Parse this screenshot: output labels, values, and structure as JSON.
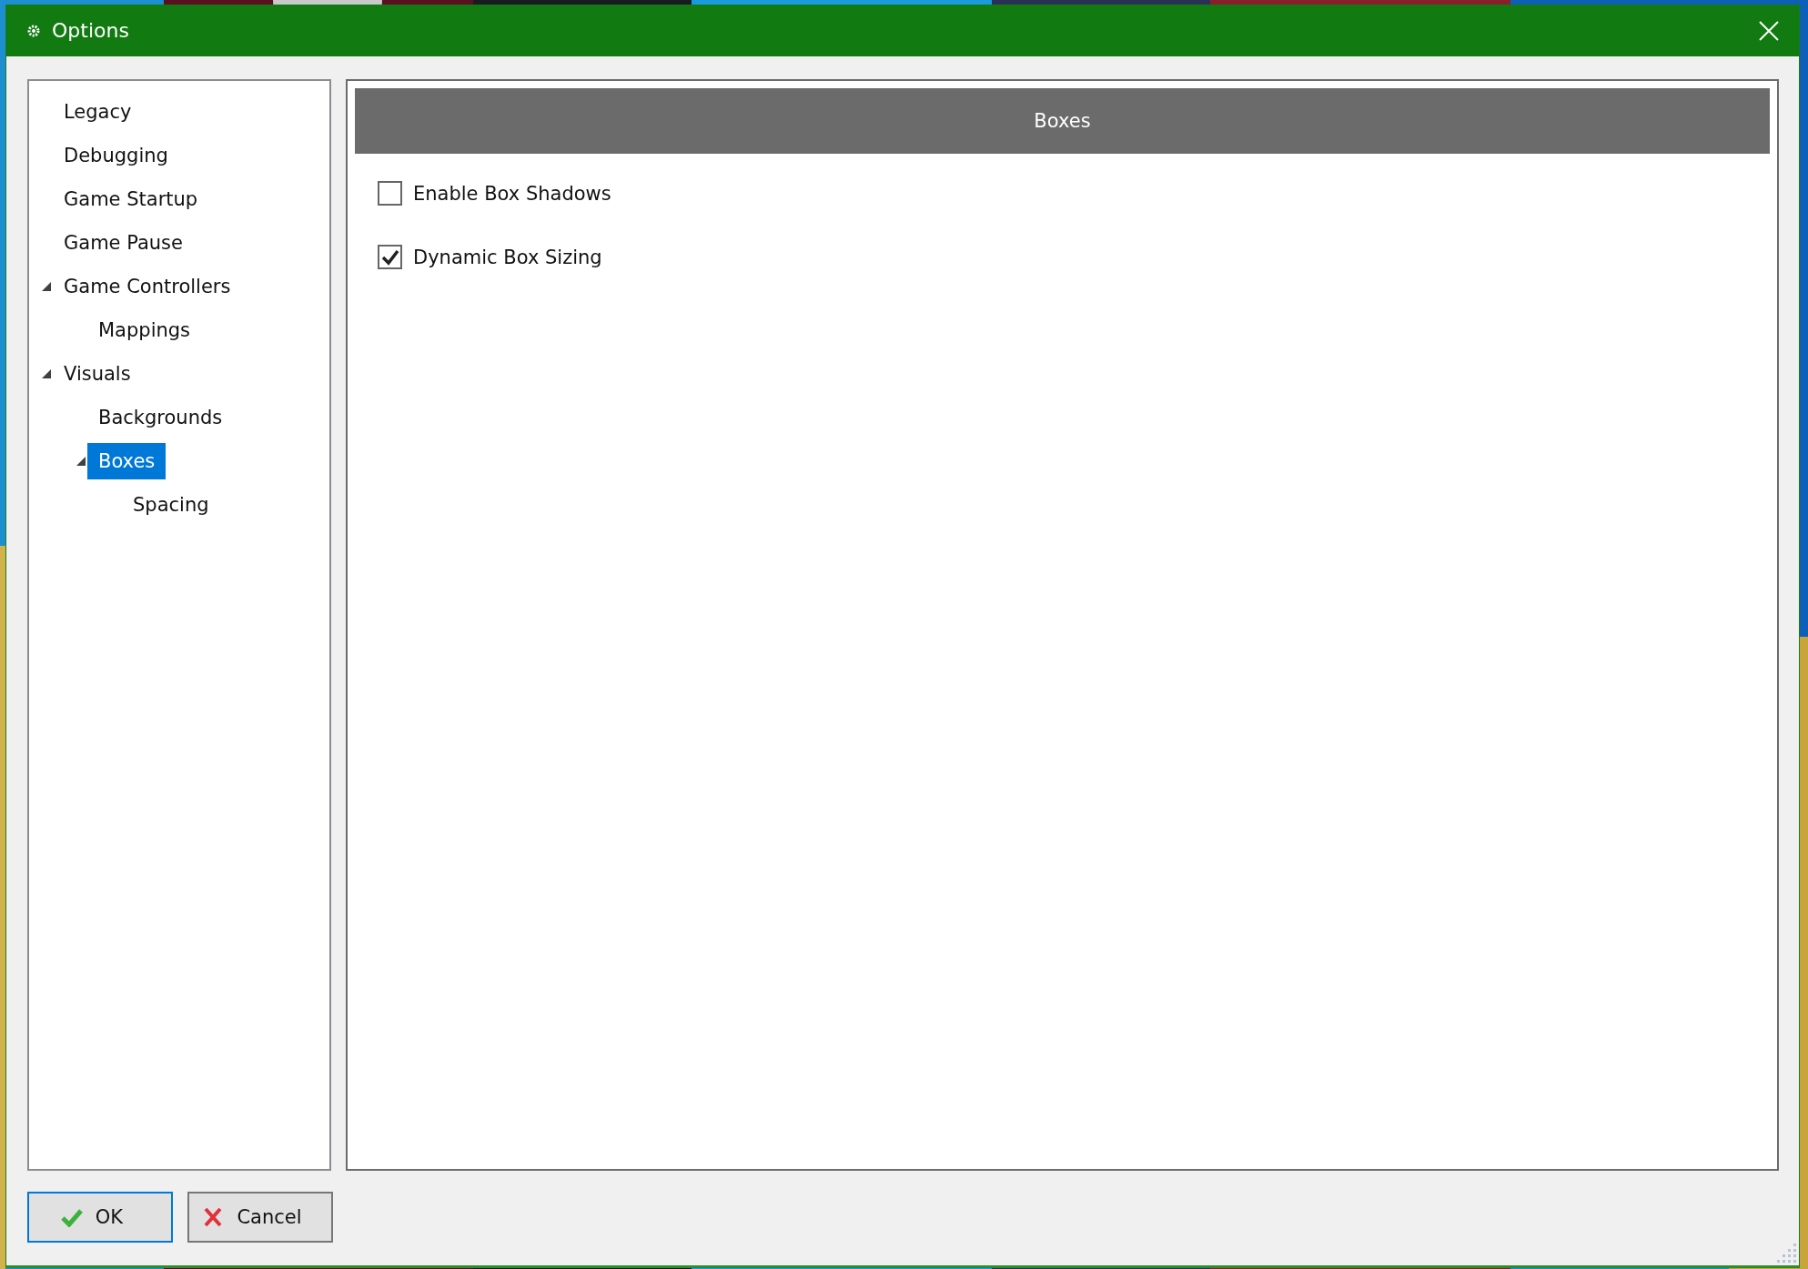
{
  "window": {
    "title": "Options"
  },
  "tree": [
    {
      "label": "Legacy",
      "selected": false
    },
    {
      "label": "Debugging",
      "selected": false
    },
    {
      "label": "Game Startup",
      "selected": false
    },
    {
      "label": "Game Pause",
      "selected": false
    },
    {
      "label": "Game Controllers",
      "selected": false,
      "expanded": true,
      "children": [
        {
          "label": "Mappings",
          "selected": false
        }
      ]
    },
    {
      "label": "Visuals",
      "selected": false,
      "expanded": true,
      "children": [
        {
          "label": "Backgrounds",
          "selected": false
        },
        {
          "label": "Boxes",
          "selected": true,
          "expanded": true,
          "children": [
            {
              "label": "Spacing",
              "selected": false
            }
          ]
        }
      ]
    }
  ],
  "panel": {
    "header": "Boxes",
    "options": [
      {
        "label": "Enable Box Shadows",
        "checked": false
      },
      {
        "label": "Dynamic Box Sizing",
        "checked": true
      }
    ]
  },
  "buttons": [
    {
      "label": "OK",
      "kind": "ok",
      "focused": true
    },
    {
      "label": "Cancel",
      "kind": "cancel",
      "focused": false
    }
  ]
}
